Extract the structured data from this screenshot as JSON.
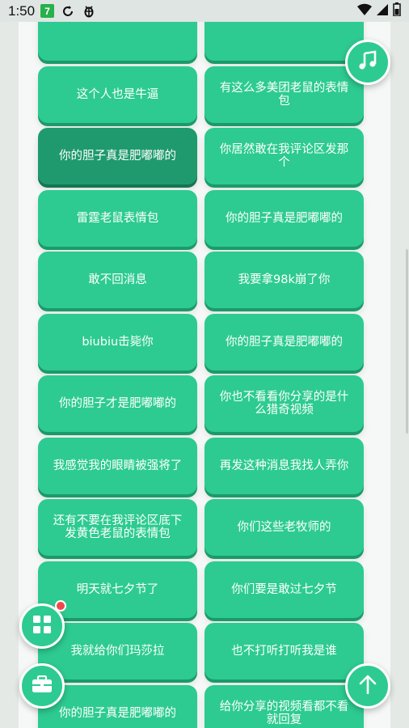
{
  "status_bar": {
    "time": "1:50",
    "badge": "7",
    "icons": [
      "sync-icon",
      "bug-icon",
      "wifi-icon",
      "signal-icon",
      "battery-icon"
    ]
  },
  "cards": [
    {
      "label": ""
    },
    {
      "label": ""
    },
    {
      "label": "这个人也是牛逼"
    },
    {
      "label": "有这么多美团老鼠的表情包"
    },
    {
      "label": "你的胆子真是肥嘟嘟的"
    },
    {
      "label": "你居然敢在我评论区发那个"
    },
    {
      "label": "雷霆老鼠表情包"
    },
    {
      "label": "你的胆子真是肥嘟嘟的"
    },
    {
      "label": "敢不回消息"
    },
    {
      "label": "我要拿98k崩了你"
    },
    {
      "label": "biubiu击毙你"
    },
    {
      "label": "你的胆子真是肥嘟嘟的"
    },
    {
      "label": "你的胆子才是肥嘟嘟的"
    },
    {
      "label": "你也不看看你分享的是什么猎奇视频"
    },
    {
      "label": "我感觉我的眼睛被强将了"
    },
    {
      "label": "再发这种消息我找人弄你"
    },
    {
      "label": "还有不要在我评论区底下发黄色老鼠的表情包"
    },
    {
      "label": "你们这些老牧师的"
    },
    {
      "label": "明天就七夕节了"
    },
    {
      "label": "你们要是敢过七夕节"
    },
    {
      "label": "我就给你们玛莎拉"
    },
    {
      "label": "也不打听打听我是谁"
    },
    {
      "label": "你的胆子真是肥嘟嘟的"
    },
    {
      "label": "给你分享的视频看都不看就回复"
    }
  ],
  "fabs": {
    "music": "music-note-icon",
    "grid": "grid-icon",
    "toolbox": "toolbox-icon",
    "scroll_top": "arrow-up-icon"
  },
  "colors": {
    "card": "#2dcb91",
    "card_pressed": "#1f9a6e",
    "notification_dot": "#f0484a"
  }
}
